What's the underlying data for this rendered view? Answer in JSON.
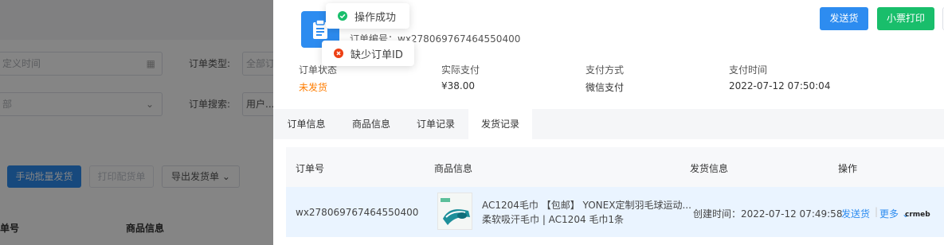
{
  "background": {
    "date_placeholder": "定义时间",
    "order_type_label": "订单类型:",
    "order_type_value": "全部订",
    "status_select_value": "部",
    "order_search_label": "订单搜索:",
    "order_search_value": "用户...",
    "batch_ship_button": "手动批量发货",
    "print_picking_button": "打印配货单",
    "export_ship_button": "导出发货单",
    "col_order_no": "单号",
    "col_product_info": "商品信息"
  },
  "drawer": {
    "order_no": "订单编号：wx278069767464550400",
    "ship_button": "发送货",
    "print_ticket_button": "小票打印",
    "summary": [
      {
        "label": "订单状态",
        "value": "未发货",
        "warn": true
      },
      {
        "label": "实际支付",
        "value": "¥38.00",
        "warn": false
      },
      {
        "label": "支付方式",
        "value": "微信支付",
        "warn": false
      },
      {
        "label": "支付时间",
        "value": "2022-07-12 07:50:04",
        "warn": false
      }
    ],
    "tabs": [
      {
        "label": "订单信息",
        "active": false
      },
      {
        "label": "商品信息",
        "active": false
      },
      {
        "label": "订单记录",
        "active": false
      },
      {
        "label": "发货记录",
        "active": true
      }
    ],
    "table": {
      "headers": [
        "订单号",
        "商品信息",
        "发货信息",
        "操作"
      ],
      "rows": [
        {
          "order_no": "wx278069767464550400",
          "product_line1": "AC1204毛巾 【包邮】 YONEX定制羽毛球运动...",
          "product_line2": "柔软吸汗毛巾 | AC1204 毛巾1条",
          "ship_info": "创建时间：2022-07-12 07:49:58",
          "action_ship": "发送货",
          "action_more": "更多"
        }
      ]
    },
    "watermark": "crmeb"
  },
  "toasts": {
    "success": "操作成功",
    "error": "缺少订单ID"
  },
  "colors": {
    "primary": "#2d8cf0",
    "success": "#19be6b",
    "warning": "#ff7d00",
    "error": "#ed4014"
  }
}
